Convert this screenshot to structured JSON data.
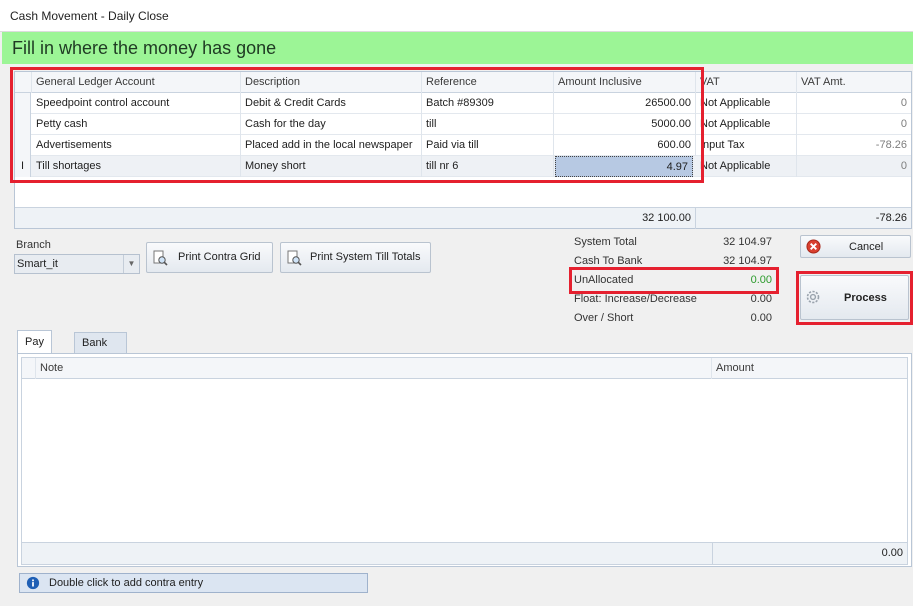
{
  "window": {
    "title": "Cash Movement - Daily Close"
  },
  "banner": {
    "text": "Fill in where the money has gone"
  },
  "grid": {
    "columns": [
      "General Ledger Account",
      "Description",
      "Reference",
      "Amount Inclusive",
      "VAT",
      "VAT Amt."
    ],
    "rows": [
      {
        "account": "Speedpoint control account",
        "description": "Debit & Credit Cards",
        "reference": "Batch #89309",
        "amount": "26500.00",
        "vat": "Not Applicable",
        "vat_amt": "0"
      },
      {
        "account": "Petty cash",
        "description": "Cash for the day",
        "reference": "till",
        "amount": "5000.00",
        "vat": "Not Applicable",
        "vat_amt": "0"
      },
      {
        "account": "Advertisements",
        "description": "Placed add in the local newspaper",
        "reference": "Paid via till",
        "amount": "600.00",
        "vat": "Input Tax",
        "vat_amt": "-78.26"
      },
      {
        "account": "Till shortages",
        "description": "Money short",
        "reference": "till nr 6",
        "amount": "4.97",
        "vat": "Not Applicable",
        "vat_amt": "0"
      }
    ],
    "active_row_marker": "I",
    "footer": {
      "amount_total": "32 100.00",
      "vat_total": "-78.26"
    }
  },
  "branch": {
    "label": "Branch",
    "value": "Smart_it"
  },
  "buttons": {
    "print_contra": "Print Contra Grid",
    "print_system": "Print System Till Totals",
    "cancel": "Cancel",
    "process": "Process"
  },
  "totals": [
    {
      "label": "System Total",
      "value": "32 104.97"
    },
    {
      "label": "Cash To Bank",
      "value": "32 104.97"
    },
    {
      "label": "UnAllocated",
      "value": "0.00"
    },
    {
      "label": "Float: Increase/Decrease",
      "value": "0.00"
    },
    {
      "label": "Over / Short",
      "value": "0.00"
    }
  ],
  "tabs": [
    "Pay Out",
    "Bank Deposit"
  ],
  "payout": {
    "columns": [
      "Note",
      "Amount"
    ],
    "footer_total": "0.00"
  },
  "info": {
    "text": "Double click to add contra entry"
  },
  "colors": {
    "banner": "#9cf596",
    "highlight": "#e5202f",
    "unallocated": "#2c9b2c"
  }
}
